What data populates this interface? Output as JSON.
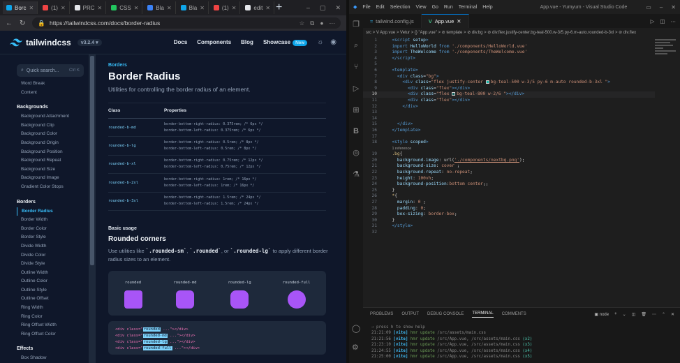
{
  "browser": {
    "tabs": [
      {
        "label": "Borc",
        "color": "#0ea5e9"
      },
      {
        "label": "(1)",
        "color": "#ef4444"
      },
      {
        "label": "PRC",
        "color": "#e5e7eb"
      },
      {
        "label": "CSS",
        "color": "#22c55e"
      },
      {
        "label": "Bla",
        "color": "#3b82f6"
      },
      {
        "label": "Bla",
        "color": "#0ea5e9"
      },
      {
        "label": "(1)",
        "color": "#ef4444"
      },
      {
        "label": "edit",
        "color": "#e5e7eb"
      }
    ],
    "url": "https://tailwindcss.com/docs/border-radius"
  },
  "tw": {
    "logo": "tailwindcss",
    "version": "v3.2.4",
    "nav": [
      "Docs",
      "Components",
      "Blog",
      "Showcase"
    ],
    "new_badge": "New",
    "search_placeholder": "Quick search...",
    "search_kbd": "Ctrl K",
    "sidebar": [
      {
        "t": "item",
        "label": "Word Break"
      },
      {
        "t": "item",
        "label": "Content"
      },
      {
        "t": "head",
        "label": "Backgrounds"
      },
      {
        "t": "item",
        "label": "Background Attachment"
      },
      {
        "t": "item",
        "label": "Background Clip"
      },
      {
        "t": "item",
        "label": "Background Color"
      },
      {
        "t": "item",
        "label": "Background Origin"
      },
      {
        "t": "item",
        "label": "Background Position"
      },
      {
        "t": "item",
        "label": "Background Repeat"
      },
      {
        "t": "item",
        "label": "Background Size"
      },
      {
        "t": "item",
        "label": "Background Image"
      },
      {
        "t": "item",
        "label": "Gradient Color Stops"
      },
      {
        "t": "head",
        "label": "Borders"
      },
      {
        "t": "active",
        "label": "Border Radius"
      },
      {
        "t": "item",
        "label": "Border Width"
      },
      {
        "t": "item",
        "label": "Border Color"
      },
      {
        "t": "item",
        "label": "Border Style"
      },
      {
        "t": "item",
        "label": "Divide Width"
      },
      {
        "t": "item",
        "label": "Divide Color"
      },
      {
        "t": "item",
        "label": "Divide Style"
      },
      {
        "t": "item",
        "label": "Outline Width"
      },
      {
        "t": "item",
        "label": "Outline Color"
      },
      {
        "t": "item",
        "label": "Outline Style"
      },
      {
        "t": "item",
        "label": "Outline Offset"
      },
      {
        "t": "item",
        "label": "Ring Width"
      },
      {
        "t": "item",
        "label": "Ring Color"
      },
      {
        "t": "item",
        "label": "Ring Offset Width"
      },
      {
        "t": "item",
        "label": "Ring Offset Color"
      },
      {
        "t": "head",
        "label": "Effects"
      },
      {
        "t": "item",
        "label": "Box Shadow"
      }
    ],
    "eyebrow": "Borders",
    "title": "Border Radius",
    "subtitle": "Utilities for controlling the border radius of an element.",
    "table_head": [
      "Class",
      "Properties"
    ],
    "table_rows": [
      {
        "cls": "rounded-b-md",
        "p1": "border-bottom-right-radius: 0.375rem; /* 6px */",
        "p2": "border-bottom-left-radius: 0.375rem; /* 6px */"
      },
      {
        "cls": "rounded-b-lg",
        "p1": "border-bottom-right-radius: 0.5rem; /* 8px */",
        "p2": "border-bottom-left-radius: 0.5rem; /* 8px */"
      },
      {
        "cls": "rounded-b-xl",
        "p1": "border-bottom-right-radius: 0.75rem; /* 12px */",
        "p2": "border-bottom-left-radius: 0.75rem; /* 12px */"
      },
      {
        "cls": "rounded-b-2xl",
        "p1": "border-bottom-right-radius: 1rem; /* 16px */",
        "p2": "border-bottom-left-radius: 1rem; /* 16px */"
      },
      {
        "cls": "rounded-b-3xl",
        "p1": "border-bottom-right-radius: 1.5rem; /* 24px */",
        "p2": "border-bottom-left-radius: 1.5rem; /* 24px */"
      }
    ],
    "basic_usage": "Basic usage",
    "section_title": "Rounded corners",
    "para_pre": "Use utilities like ",
    "para_c1": "`.rounded-sm`",
    "para_sep1": ", ",
    "para_c2": "`.rounded`",
    "para_sep2": ", or ",
    "para_c3": "`.rounded-lg`",
    "para_post": " to apply different border radius sizes to an element.",
    "demo": [
      {
        "label": "rounded",
        "radius": "rounded"
      },
      {
        "label": "rounded-md",
        "radius": "md"
      },
      {
        "label": "rounded-lg",
        "radius": "lg"
      },
      {
        "label": "rounded-full",
        "radius": "full"
      }
    ],
    "code_lines": [
      {
        "pre": "<div class=\"",
        "cls": "rounded",
        "post": " ...\"></div>"
      },
      {
        "pre": "<div class=\"",
        "cls": "rounded-md",
        "post": " ...\"></div>"
      },
      {
        "pre": "<div class=\"",
        "cls": "rounded-lg",
        "post": " ...\"></div>"
      },
      {
        "pre": "<div class=\"",
        "cls": "rounded-full",
        "post": " ...\"></div>"
      }
    ],
    "accent": "#a855f7"
  },
  "vscode": {
    "menu": [
      "File",
      "Edit",
      "Selection",
      "View",
      "Go",
      "Run",
      "Terminal",
      "Help"
    ],
    "window_title": "App.vue - Yumyum - Visual Studio Code",
    "tabs": [
      {
        "label": "tailwind.config.js",
        "active": false
      },
      {
        "label": "App.vue",
        "active": true
      }
    ],
    "breadcrumb": "src > V App.vue > Vetur > {} \"App.vue\" > ⊘ template > ⊘ div.bg > ⊘ div.flex.justify-center.bg-teal-500.w-3/5.py-6.m-auto.rounded-b-3xl > ⊘ div.flex",
    "current_line": 10,
    "code": [
      {
        "n": 1,
        "h": "  <span class='kw'>&lt;script</span> <span class='attr'>setup</span><span class='kw'>&gt;</span>"
      },
      {
        "n": 2,
        "h": "  <span class='kw'>import</span> <span class='attr'>HelloWorld</span> <span class='kw'>from</span> <span class='str'>'./components/HelloWorld.vue'</span>"
      },
      {
        "n": 3,
        "h": "  <span class='kw'>import</span> <span class='attr'>TheWelcome</span> <span class='kw'>from</span> <span class='str'>'./components/TheWelcome.vue'</span>"
      },
      {
        "n": 4,
        "h": "  <span class='kw'>&lt;/script&gt;</span>"
      },
      {
        "n": 5,
        "h": ""
      },
      {
        "n": 6,
        "h": "  <span class='kw'>&lt;template&gt;</span>"
      },
      {
        "n": 7,
        "h": "    <span class='kw'>&lt;div</span> <span class='attr'>class</span>=<span class='str'>\"bg\"</span><span class='kw'>&gt;</span>"
      },
      {
        "n": 8,
        "h": "      <span class='kw'>&lt;div</span> <span class='attr'>class</span>=<span class='str'>\"flex justify-center <span class='sw' style='background:#14b8a6'></span>bg-teal-500 w-3/5 py-6 m-auto rounded-b-3xl \"</span><span class='kw'>&gt;</span>"
      },
      {
        "n": 9,
        "h": "        <span class='kw'>&lt;div</span> <span class='attr'>class</span>=<span class='str'>\"flex\"</span><span class='kw'>&gt;&lt;/div&gt;</span>"
      },
      {
        "n": 10,
        "h": "        <span class='kw'>&lt;div</span> <span class='attr'>class</span>=<span class='str'>\"flex <span class='sw' style='background:#115e59'></span>bg-teal-800 w-2/6 \"</span><span class='kw'>&gt;&lt;/div&gt;</span>"
      },
      {
        "n": 11,
        "h": "        <span class='kw'>&lt;div</span> <span class='attr'>class</span>=<span class='str'>\"flex\"</span><span class='kw'>&gt;&lt;/div&gt;</span>"
      },
      {
        "n": 12,
        "h": "      <span class='kw'>&lt;/div&gt;</span>"
      },
      {
        "n": 13,
        "h": ""
      },
      {
        "n": 14,
        "h": ""
      },
      {
        "n": 15,
        "h": "    <span class='kw'>&lt;/div&gt;</span>"
      },
      {
        "n": 16,
        "h": "  <span class='kw'>&lt;/template&gt;</span>"
      },
      {
        "n": 17,
        "h": ""
      },
      {
        "n": 18,
        "h": "  <span class='kw'>&lt;style</span> <span class='attr'>scoped</span><span class='kw'>&gt;</span>"
      },
      {
        "n": null,
        "h": "  <span class='ref'>1 reference</span>"
      },
      {
        "n": 19,
        "h": "  <span class='sel'>.bg</span><span class='tx'>{</span>"
      },
      {
        "n": 20,
        "h": "    <span class='prop'>background-image</span><span class='tx'>: url(</span><span class='lnk'>'./components/nextbg.png'</span><span class='tx'>);</span>"
      },
      {
        "n": 21,
        "h": "    <span class='prop'>background-size</span><span class='tx'>: </span><span class='val'>cover</span><span class='tx'> ;</span>"
      },
      {
        "n": 22,
        "h": "    <span class='prop'>background-repeat</span><span class='tx'>: </span><span class='val'>no-repeat</span><span class='tx'>;</span>"
      },
      {
        "n": 23,
        "h": "    <span class='prop'>height</span><span class='tx'>: </span><span class='val'>100vh</span><span class='tx'>;</span>"
      },
      {
        "n": 24,
        "h": "    <span class='prop'>background-position</span><span class='tx'>:</span><span class='val'>bottom center</span><span class='tx'>;;</span>"
      },
      {
        "n": 25,
        "h": "  <span class='tx'>}</span>"
      },
      {
        "n": 26,
        "h": "  <span class='sel'>*</span><span class='tx'>{</span>"
      },
      {
        "n": 27,
        "h": "    <span class='prop'>margin</span><span class='tx'>: </span><span class='val'>0</span><span class='tx'> ;</span>"
      },
      {
        "n": 28,
        "h": "    <span class='prop'>padding</span><span class='tx'>: </span><span class='val'>0</span><span class='tx'>;</span>"
      },
      {
        "n": 29,
        "h": "    <span class='prop'>box-sizing</span><span class='tx'>: </span><span class='val'>border-box</span><span class='tx'>;</span>"
      },
      {
        "n": 30,
        "h": "  <span class='tx'>}</span>"
      },
      {
        "n": 31,
        "h": "  <span class='kw'>&lt;/style&gt;</span>"
      },
      {
        "n": 32,
        "h": ""
      }
    ],
    "panel_tabs": [
      "PROBLEMS",
      "OUTPUT",
      "DEBUG CONSOLE",
      "TERMINAL",
      "COMMENTS"
    ],
    "active_panel": "TERMINAL",
    "terminal_shell": "node",
    "terminal_hint": "→ press h to show help",
    "terminal": [
      {
        "time": "21:21:09",
        "file": "/src/assets/main.css",
        "count": ""
      },
      {
        "time": "21:21:56",
        "file": "/src/App.vue, /src/assets/main.css",
        "count": "(x2)"
      },
      {
        "time": "21:23:10",
        "file": "/src/App.vue, /src/assets/main.css",
        "count": "(x3)"
      },
      {
        "time": "21:24:55",
        "file": "/src/App.vue, /src/assets/main.css",
        "count": "(x4)"
      },
      {
        "time": "21:25:00",
        "file": "/src/App.vue, /src/assets/main.css",
        "count": "(x5)"
      }
    ],
    "terminal_tag": "[vite]",
    "terminal_msg": "hmr update"
  }
}
